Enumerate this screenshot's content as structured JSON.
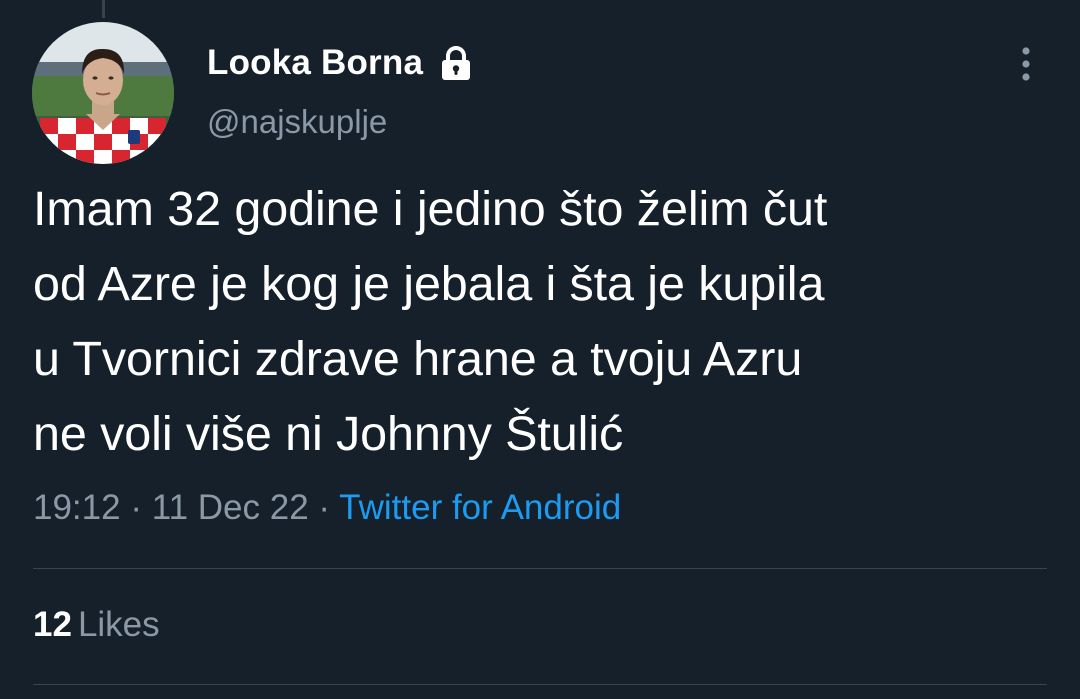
{
  "tweet": {
    "author": {
      "display_name": "Looka Borna",
      "handle": "@najskuplje",
      "avatar_icon": "user-avatar-photo",
      "protected_icon": "lock-icon"
    },
    "text_lines": [
      "Imam 32 godine i jedino što želim čut",
      "od Azre je kog je jebala i šta je kupila",
      "u Tvornici zdrave hrane a tvoju Azru",
      "ne voli više ni Johnny Štulić"
    ],
    "meta": {
      "time": "19:12",
      "separator": "·",
      "date": "11 Dec 22",
      "source": "Twitter for Android"
    },
    "stats": {
      "likes_count": "12",
      "likes_label": "Likes"
    },
    "more_icon": "more-vertical-icon"
  },
  "colors": {
    "background": "#15202b",
    "text_primary": "#ffffff",
    "text_secondary": "#8b98a5",
    "link": "#1d9bf0",
    "divider": "#38444d"
  }
}
